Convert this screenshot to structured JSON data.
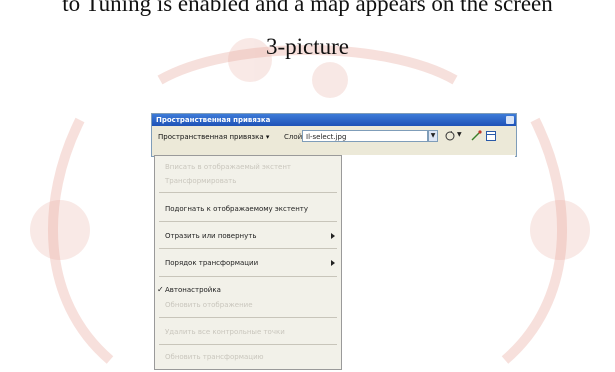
{
  "caption_line": "to Tuning is enabled and a map appears on the screen",
  "figure_label": "3-picture",
  "window": {
    "title": "Пространственная привязка",
    "menu_label": "Пространственная привязка ▾",
    "layer_label": "Слой:",
    "layer_value": "Il-select.jpg"
  },
  "menu": {
    "items": [
      {
        "label": "Вписать в отображаемый экстент",
        "disabled": true
      },
      {
        "label": "Трансформировать",
        "disabled": true
      },
      {
        "label": "Подогнать к отображаемому экстенту",
        "disabled": false
      },
      {
        "label": "Отразить или повернуть",
        "disabled": false,
        "submenu": true
      },
      {
        "label": "Порядок трансформации",
        "disabled": false,
        "submenu": true
      },
      {
        "label": "Автонастройка",
        "disabled": false,
        "checked": true
      },
      {
        "label": "Обновить отображение",
        "disabled": true
      },
      {
        "label": "Удалить все контрольные точки",
        "disabled": true
      },
      {
        "label": "Обновить трансформацию",
        "disabled": true
      }
    ]
  },
  "colors": {
    "titlebar": "#1e52b7",
    "menu_bg": "#f2f1e9",
    "watermark": "#d86a5a"
  }
}
